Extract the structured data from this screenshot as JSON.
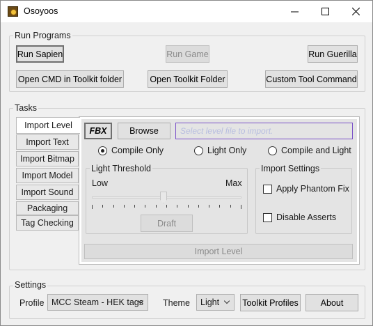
{
  "window": {
    "title": "Osoyoos"
  },
  "run_programs": {
    "label": "Run Programs",
    "run_sapien": "Run Sapien",
    "run_game": "Run Game",
    "run_guerilla": "Run Guerilla",
    "open_cmd": "Open CMD in Toolkit folder",
    "open_toolkit_folder": "Open Toolkit Folder",
    "custom_tool_command": "Custom Tool Command"
  },
  "tasks": {
    "label": "Tasks",
    "tabs": [
      {
        "label": "Import Level",
        "active": true
      },
      {
        "label": "Import Text"
      },
      {
        "label": "Import Bitmap"
      },
      {
        "label": "Import Model"
      },
      {
        "label": "Import Sound"
      },
      {
        "label": "Packaging"
      },
      {
        "label": "Tag Checking"
      }
    ],
    "import_level": {
      "fbx": "FBX",
      "browse": "Browse",
      "file_placeholder": "Select level file to import.",
      "radio_options": [
        {
          "label": "Compile Only",
          "checked": true
        },
        {
          "label": "Light Only",
          "checked": false
        },
        {
          "label": "Compile and Light",
          "checked": false
        }
      ],
      "light_threshold": {
        "label": "Light Threshold",
        "low": "Low",
        "max": "Max",
        "value_fraction": 0.48,
        "draft": "Draft"
      },
      "import_settings": {
        "label": "Import Settings",
        "apply_phantom_fix": "Apply Phantom Fix",
        "disable_asserts": "Disable Asserts"
      },
      "import_button": "Import Level"
    }
  },
  "settings": {
    "label": "Settings",
    "profile_label": "Profile",
    "profile_value": "MCC Steam - HEK tags",
    "theme_label": "Theme",
    "theme_value": "Light",
    "toolkit_profiles": "Toolkit Profiles",
    "about": "About"
  }
}
